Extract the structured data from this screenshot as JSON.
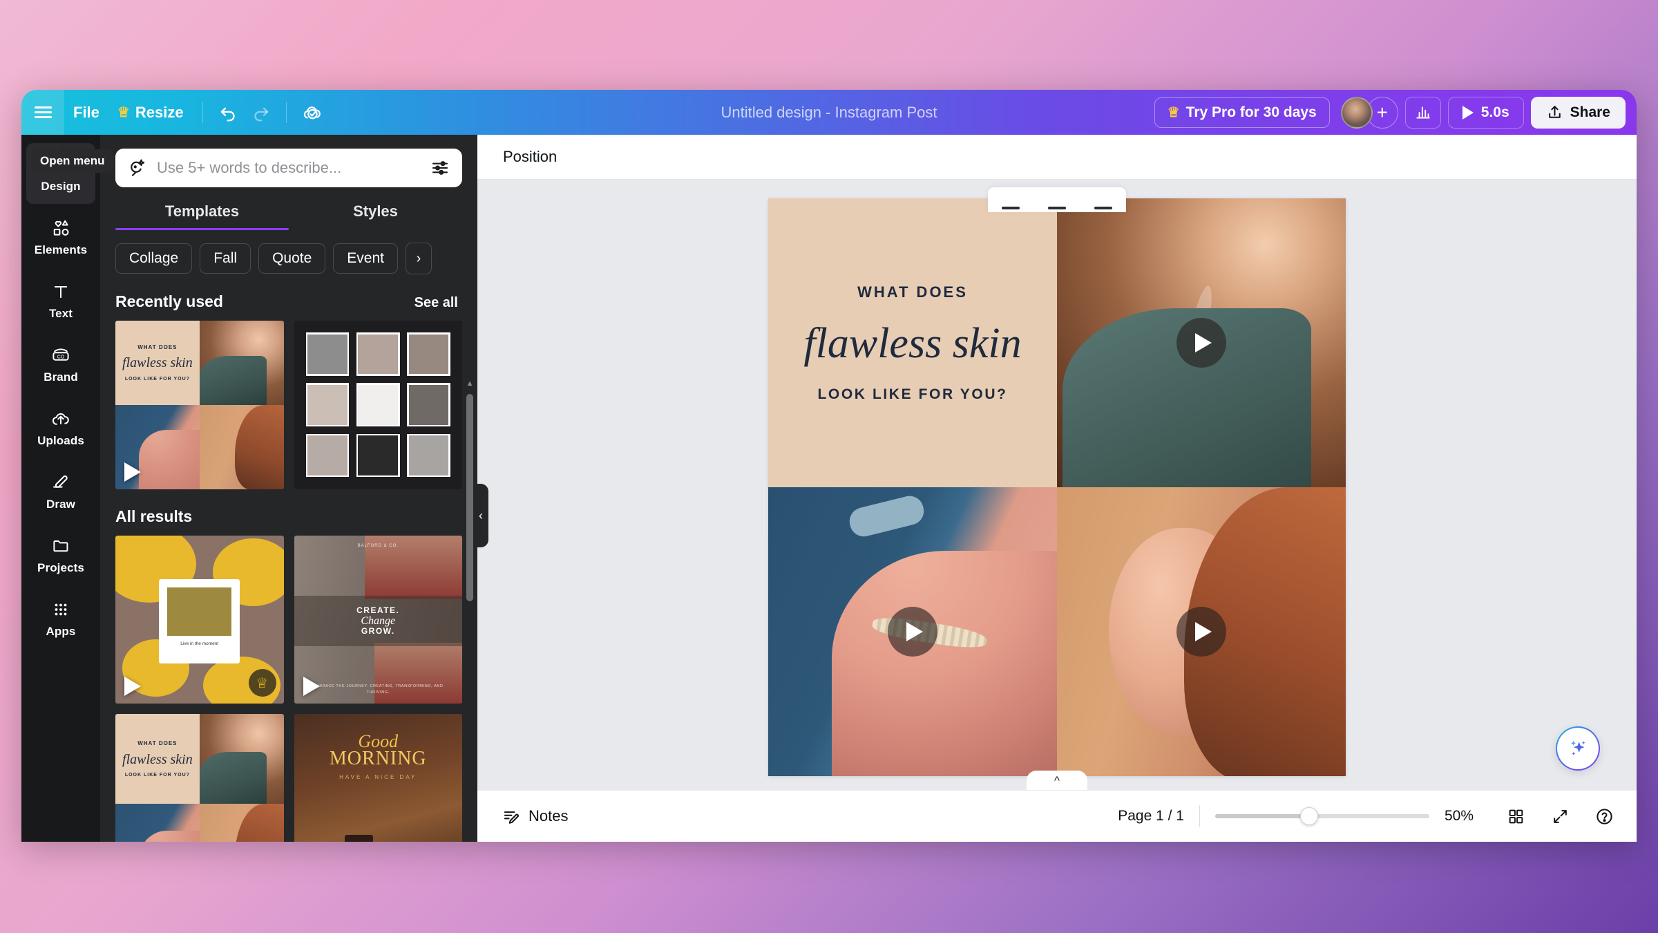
{
  "topbar": {
    "menu_tooltip": "Open menu",
    "file_label": "File",
    "resize_label": "Resize",
    "doc_title": "Untitled design - Instagram Post",
    "try_pro_label": "Try Pro for 30 days",
    "add_people_label": "+",
    "preview_duration": "5.0s",
    "share_label": "Share",
    "icons": {
      "hamburger": "hamburger-icon",
      "crown": "crown-icon",
      "undo": "undo-icon",
      "redo": "redo-icon",
      "cloud_saved": "cloud-saved-icon",
      "timing": "timing-bars-icon",
      "play": "play-icon",
      "share_upload": "upload-icon"
    }
  },
  "sidebar": {
    "items": [
      {
        "label": "Design",
        "icon": "design-icon",
        "active": true
      },
      {
        "label": "Elements",
        "icon": "elements-icon",
        "active": false
      },
      {
        "label": "Text",
        "icon": "text-icon",
        "active": false
      },
      {
        "label": "Brand",
        "icon": "brand-icon",
        "active": false
      },
      {
        "label": "Uploads",
        "icon": "uploads-icon",
        "active": false
      },
      {
        "label": "Draw",
        "icon": "draw-icon",
        "active": false
      },
      {
        "label": "Projects",
        "icon": "projects-icon",
        "active": false
      },
      {
        "label": "Apps",
        "icon": "apps-icon",
        "active": false
      }
    ]
  },
  "panel": {
    "search": {
      "placeholder": "Use 5+ words to describe...",
      "value": "",
      "search_icon": "magic-search-icon",
      "filter_icon": "filter-sliders-icon"
    },
    "tabs": [
      {
        "label": "Templates",
        "active": true
      },
      {
        "label": "Styles",
        "active": false
      }
    ],
    "chips": [
      "Collage",
      "Fall",
      "Quote",
      "Event"
    ],
    "chips_next_icon": "chevron-right-icon",
    "recently_used": {
      "title": "Recently used",
      "see_all": "See all",
      "items": [
        {
          "name": "flawless-skin-video-collage",
          "kind": "flawless",
          "has_video": true,
          "is_pro": false,
          "text": {
            "line1": "WHAT DOES",
            "line2": "flawless skin",
            "line3": "LOOK LIKE FOR YOU?"
          }
        },
        {
          "name": "photo-polaroid-collage",
          "kind": "collage",
          "has_video": false,
          "is_pro": false
        }
      ]
    },
    "all_results": {
      "title": "All results",
      "items": [
        {
          "name": "live-in-the-moment-flowers",
          "kind": "flowers",
          "has_video": true,
          "is_pro": true,
          "caption": "Live in the moment"
        },
        {
          "name": "create-change-grow",
          "kind": "create",
          "has_video": true,
          "is_pro": false,
          "brand": "BALFORD & CO.",
          "t1": "CREATE.",
          "t2": "Change",
          "t3": "GROW.",
          "footer": "EMBRACE THE JOURNEY. CREATING, TRANSFORMING, AND THRIVING."
        },
        {
          "name": "flawless-skin-video-collage-2",
          "kind": "flawless",
          "has_video": false,
          "is_pro": false,
          "text": {
            "line1": "WHAT DOES",
            "line2": "flawless skin",
            "line3": "LOOK LIKE FOR YOU?"
          }
        },
        {
          "name": "good-morning-coffee",
          "kind": "morning",
          "has_video": false,
          "is_pro": false,
          "t1": "Good",
          "t2": "MORNING",
          "t3": "HAVE A NICE DAY"
        }
      ]
    },
    "collapse_icon": "chevron-left-icon"
  },
  "editor": {
    "context_toolbar": {
      "position_label": "Position"
    },
    "design": {
      "quadrants": [
        {
          "name": "text-quadrant",
          "line1": "WHAT DOES",
          "line2": "flawless skin",
          "line3": "LOOK LIKE FOR YOU?",
          "has_play": false
        },
        {
          "name": "video-top-right",
          "has_play": true
        },
        {
          "name": "video-bottom-left",
          "has_play": true
        },
        {
          "name": "video-bottom-right",
          "has_play": true
        }
      ]
    },
    "add_comment_icon": "add-comment-icon",
    "magic_icon": "magic-sparkle-icon",
    "canvas_collapse_icon": "chevron-up-icon"
  },
  "bottombar": {
    "notes_label": "Notes",
    "notes_icon": "notes-icon",
    "page_indicator": "Page 1 / 1",
    "zoom_value": "50%",
    "grid_view_icon": "grid-view-icon",
    "fullscreen_icon": "fullscreen-icon",
    "help_icon": "help-icon"
  },
  "colors": {
    "brand_purple": "#8b3dff",
    "topbar_start": "#16c0dd",
    "topbar_end": "#8a37ec",
    "panel_bg": "#252628",
    "rail_bg": "#18191b",
    "canvas_bg": "#e8e9ed",
    "design_bg": "#e7cdb4",
    "design_text": "#1f2a3d",
    "pro_gold": "#ffce3a"
  }
}
